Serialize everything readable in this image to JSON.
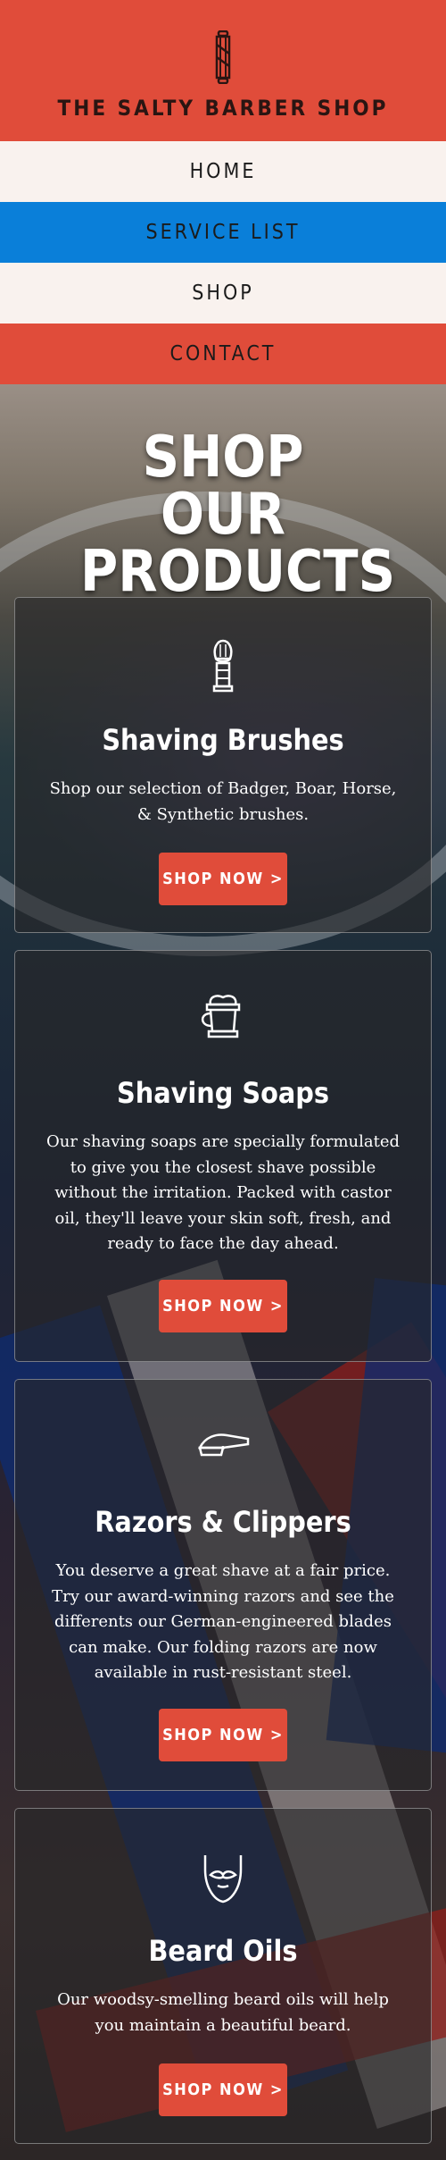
{
  "header": {
    "site_title": "THE SALTY BARBER SHOP",
    "logo_icon": "barber-pole-icon",
    "background_color": "#e04c3a"
  },
  "nav": {
    "items": [
      {
        "label": "HOME",
        "color": "#f9f2ee"
      },
      {
        "label": "SERVICE LIST",
        "color": "#0a7fd9"
      },
      {
        "label": "SHOP",
        "color": "#f9f2ee"
      },
      {
        "label": "CONTACT",
        "color": "#e04c3a"
      }
    ]
  },
  "main": {
    "heading": "SHOP OUR PRODUCTS",
    "cards": [
      {
        "icon": "shaving-brush-icon",
        "title": "Shaving Brushes",
        "text": "Shop our selection of Badger, Boar, Horse, & Synthetic brushes.",
        "button_label": "SHOP NOW >"
      },
      {
        "icon": "shaving-soap-mug-icon",
        "title": "Shaving Soaps",
        "text": "Our shaving soaps are specially formulated to give you the closest shave possible without the irritation. Packed with castor oil, they'll leave your skin soft, fresh, and ready to face the day ahead.",
        "button_label": "SHOP NOW >"
      },
      {
        "icon": "straight-razor-icon",
        "title": "Razors & Clippers",
        "text": "You deserve a great shave at a fair price. Try our award-winning razors and see the differents our German-engineered blades can make. Our folding razors are now available in rust-resistant steel.",
        "button_label": "SHOP NOW >"
      },
      {
        "icon": "beard-icon",
        "title": "Beard Oils",
        "text": "Our woodsy-smelling beard oils will help you maintain a beautiful beard.",
        "button_label": "SHOP NOW >"
      }
    ]
  },
  "colors": {
    "accent": "#e04c3a",
    "nav_blue": "#0a7fd9",
    "cream": "#f9f2ee"
  }
}
